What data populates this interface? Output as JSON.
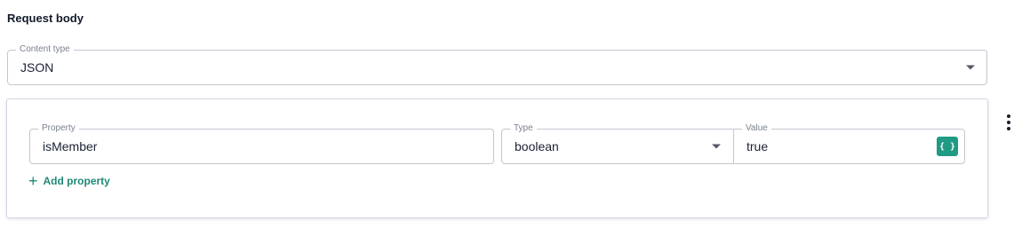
{
  "section": {
    "title": "Request body"
  },
  "content_type": {
    "label": "Content type",
    "value": "JSON"
  },
  "property_row": {
    "property": {
      "label": "Property",
      "value": "isMember"
    },
    "type": {
      "label": "Type",
      "value": "boolean"
    },
    "value": {
      "label": "Value",
      "value": "true",
      "code_button": "{ }"
    }
  },
  "add_property": {
    "icon": "+",
    "label": "Add property"
  },
  "icons": {
    "kebab": "more-vertical-icon",
    "caret": "chevron-down-icon",
    "code": "code-braces-icon"
  },
  "colors": {
    "accent": "#1f9a84",
    "text": "#1a2233",
    "border": "#c4c7cf"
  }
}
